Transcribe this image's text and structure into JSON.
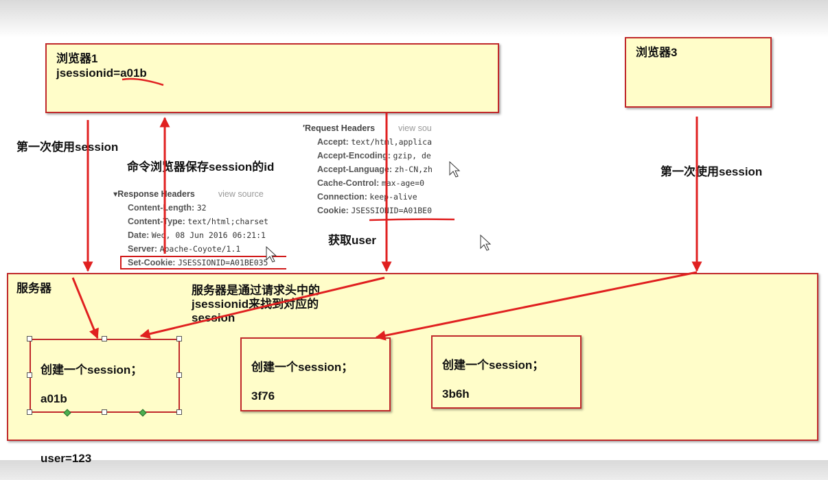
{
  "browser1": {
    "title": "浏览器1",
    "jsessionid": "jsessionid=a01b"
  },
  "browser3": {
    "title": "浏览器3"
  },
  "labels": {
    "first_use_left": "第一次使用session",
    "command_save": "命令浏览器保存session的id",
    "first_use_right": "第一次使用session",
    "get_user": "获取user",
    "server_note": "服务器是通过请求头中的jsessionid来找到对应的session"
  },
  "server": {
    "title": "服务器"
  },
  "sessions": [
    {
      "line1": "创建一个session；",
      "line2": "a01b",
      "line3": "user=123"
    },
    {
      "line1": "创建一个session；",
      "line2": "3f76"
    },
    {
      "line1": "创建一个session；",
      "line2": "3b6h"
    }
  ],
  "response_headers": {
    "title": "Response Headers",
    "view_source": "view source",
    "rows": [
      {
        "key": "Content-Length:",
        "value": "32"
      },
      {
        "key": "Content-Type:",
        "value": "text/html;charset"
      },
      {
        "key": "Date:",
        "value": "Wed, 08 Jun 2016 06:21:1"
      },
      {
        "key": "Server:",
        "value": "Apache-Coyote/1.1"
      },
      {
        "key": "Set-Cookie:",
        "value": "JSESSIONID=A01BE035"
      }
    ]
  },
  "request_headers": {
    "title": "Request Headers",
    "view_source": "view sou",
    "rows": [
      {
        "key": "Accept:",
        "value": "text/html,applica"
      },
      {
        "key": "Accept-Encoding:",
        "value": "gzip, de"
      },
      {
        "key": "Accept-Language:",
        "value": "zh-CN,zh"
      },
      {
        "key": "Cache-Control:",
        "value": "max-age=0"
      },
      {
        "key": "Connection:",
        "value": "keep-alive"
      },
      {
        "key": "Cookie:",
        "value": "JSESSIONID=A01BE0"
      }
    ]
  },
  "colors": {
    "box_fill": "#fffdc9",
    "border": "#c0282a",
    "arrow": "#e02020"
  }
}
